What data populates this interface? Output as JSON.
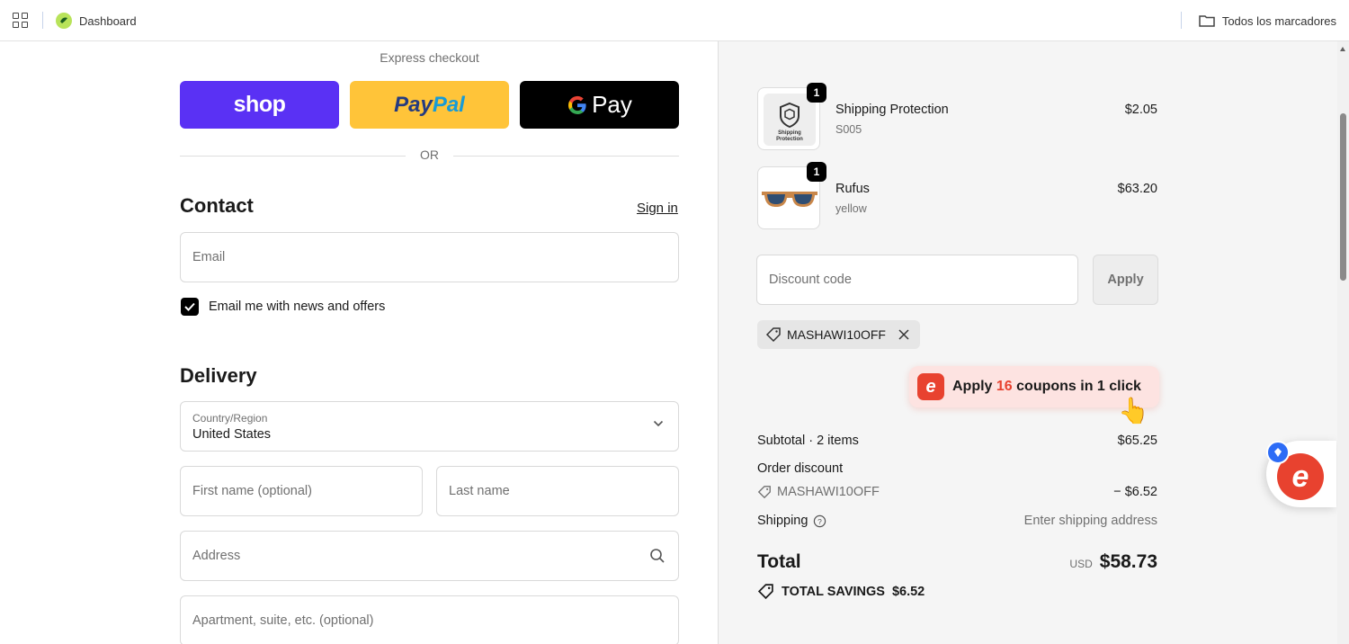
{
  "bookmarks_bar": {
    "dashboard_label": "Dashboard",
    "folder_label": "Todos los marcadores"
  },
  "express": {
    "label": "Express checkout",
    "shop_label": "shop",
    "paypal_part1": "Pay",
    "paypal_part2": "Pal",
    "gpay_label": "Pay",
    "or_label": "OR"
  },
  "contact": {
    "heading": "Contact",
    "sign_in": "Sign in",
    "email_placeholder": "Email",
    "newsletter_label": "Email me with news and offers",
    "newsletter_checked": true
  },
  "delivery": {
    "heading": "Delivery",
    "country_label": "Country/Region",
    "country_value": "United States",
    "first_name_placeholder": "First name (optional)",
    "last_name_placeholder": "Last name",
    "address_placeholder": "Address",
    "apartment_placeholder": "Apartment, suite, etc. (optional)"
  },
  "cart": {
    "items": [
      {
        "qty": "1",
        "name": "Shipping Protection",
        "variant": "S005",
        "price": "$2.05",
        "thumb_text": "Shipping Protection"
      },
      {
        "qty": "1",
        "name": "Rufus",
        "variant": "yellow",
        "price": "$63.20"
      }
    ],
    "discount_placeholder": "Discount code",
    "apply_label": "Apply",
    "applied_code": "MASHAWI10OFF"
  },
  "coupon_popup": {
    "prefix": "Apply",
    "count": "16",
    "suffix": "coupons in 1 click",
    "logo_letter": "e"
  },
  "summary": {
    "subtotal_label": "Subtotal · 2 items",
    "subtotal_value": "$65.25",
    "order_discount_label": "Order discount",
    "discount_code": "MASHAWI10OFF",
    "discount_value": "− $6.52",
    "shipping_label": "Shipping",
    "shipping_value": "Enter shipping address",
    "total_label": "Total",
    "currency": "USD",
    "total_value": "$58.73",
    "savings_label": "TOTAL SAVINGS",
    "savings_value": "$6.52"
  },
  "colors": {
    "shop_purple": "#5a31f4",
    "paypal_yellow": "#ffc439",
    "coupon_red": "#e8422f"
  }
}
